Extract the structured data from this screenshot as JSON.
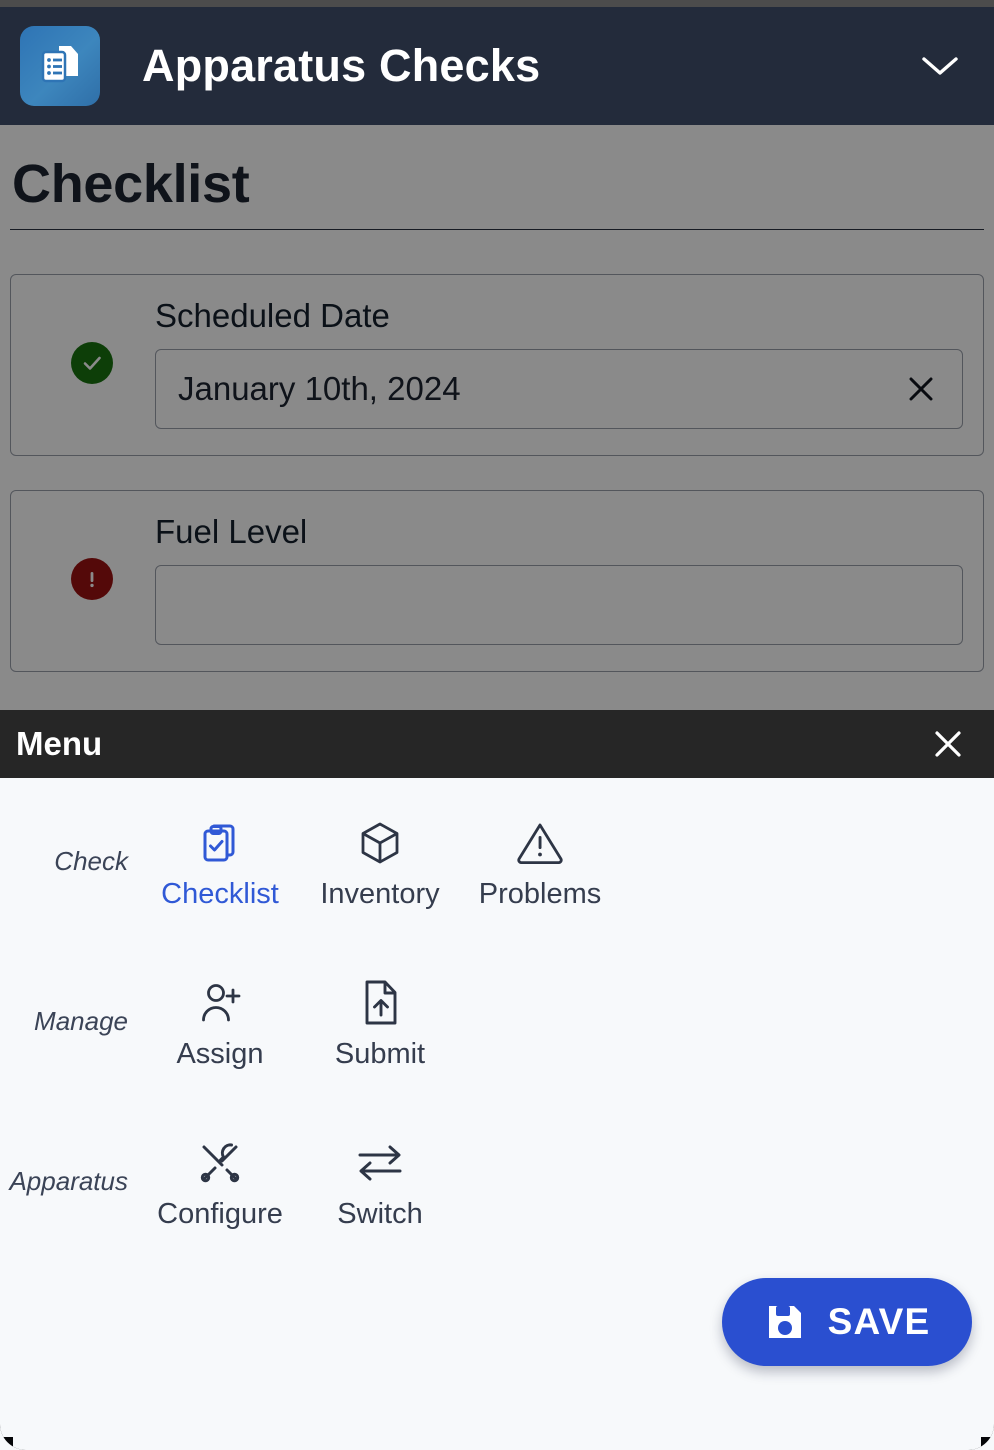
{
  "appbar": {
    "title": "Apparatus Checks",
    "logo_icon": "documents-list-icon",
    "expand_icon": "chevron-down-icon"
  },
  "page": {
    "title": "Checklist",
    "fields": [
      {
        "status": "ok",
        "status_icon": "check-circle-icon",
        "label": "Scheduled Date",
        "value": "January 10th, 2024",
        "clear_icon": "close-icon"
      },
      {
        "status": "warn",
        "status_icon": "alert-circle-icon",
        "label": "Fuel Level",
        "value": "",
        "placeholder": ""
      }
    ]
  },
  "sheet": {
    "title": "Menu",
    "close_icon": "close-icon",
    "groups": [
      {
        "label": "Check",
        "items": [
          {
            "label": "Checklist",
            "icon": "clipboard-check-icon",
            "active": true
          },
          {
            "label": "Inventory",
            "icon": "cube-icon",
            "active": false
          },
          {
            "label": "Problems",
            "icon": "warning-triangle-icon",
            "active": false
          }
        ]
      },
      {
        "label": "Manage",
        "items": [
          {
            "label": "Assign",
            "icon": "user-plus-icon",
            "active": false
          },
          {
            "label": "Submit",
            "icon": "file-upload-icon",
            "active": false
          }
        ]
      },
      {
        "label": "Apparatus",
        "items": [
          {
            "label": "Configure",
            "icon": "tools-icon",
            "active": false
          },
          {
            "label": "Switch",
            "icon": "swap-arrows-icon",
            "active": false
          }
        ]
      }
    ]
  },
  "save": {
    "label": "SAVE",
    "icon": "floppy-disk-icon"
  },
  "colors": {
    "appbar_bg": "#232b3b",
    "sheet_header_bg": "#262626",
    "sheet_bg": "#f7f9fb",
    "accent_blue": "#3059d6",
    "save_blue": "#2a4fd0",
    "status_ok_green": "#18730f",
    "status_warn_red": "#9c1111"
  }
}
